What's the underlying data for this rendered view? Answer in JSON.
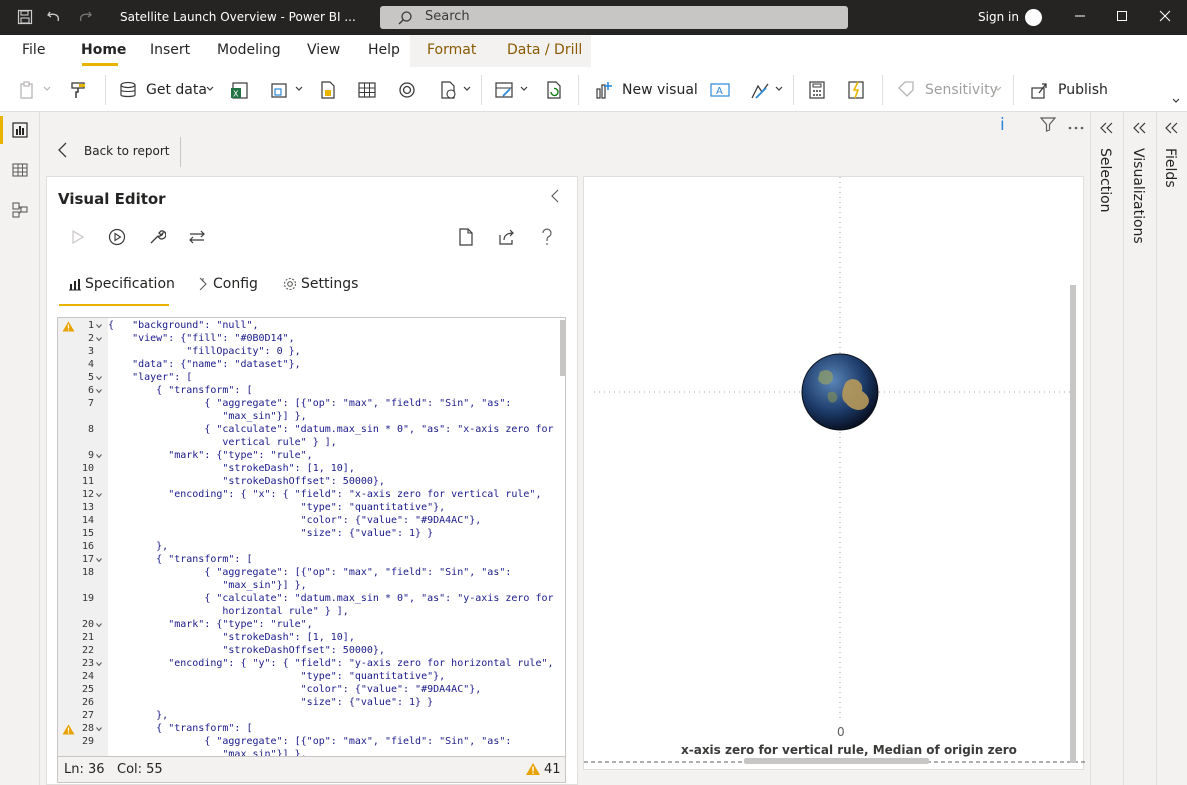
{
  "window": {
    "title": "Satellite Launch Overview - Power BI ...",
    "search_label": "Search",
    "sign_in": "Sign in"
  },
  "menu": {
    "items": [
      "File",
      "Home",
      "Insert",
      "Modeling",
      "View",
      "Help",
      "Format",
      "Data / Drill"
    ],
    "active": "Home"
  },
  "ribbon": {
    "get_data": "Get data",
    "new_visual": "New visual",
    "sensitivity": "Sensitivity",
    "publish": "Publish"
  },
  "report": {
    "back_label": "Back to report",
    "info_glyph": "i"
  },
  "editor": {
    "title": "Visual Editor",
    "tabs": [
      "Specification",
      "Config",
      "Settings"
    ],
    "active_tab": "Specification",
    "status_line": "Ln: 36",
    "status_col": "Col: 55",
    "warning_count": "41",
    "code_lines": [
      {
        "n": "1",
        "fold": true,
        "warn": true,
        "text": "{   \"background\": \"null\","
      },
      {
        "n": "2",
        "fold": true,
        "warn": false,
        "text": "    \"view\": {\"fill\": \"#0B0D14\","
      },
      {
        "n": "3",
        "fold": false,
        "warn": false,
        "text": "             \"fillOpacity\": 0 },"
      },
      {
        "n": "4",
        "fold": false,
        "warn": false,
        "text": "    \"data\": {\"name\": \"dataset\"},"
      },
      {
        "n": "5",
        "fold": true,
        "warn": false,
        "text": "    \"layer\": ["
      },
      {
        "n": "6",
        "fold": true,
        "warn": false,
        "text": "        { \"transform\": ["
      },
      {
        "n": "7",
        "fold": false,
        "warn": false,
        "text": "                { \"aggregate\": [{\"op\": \"max\", \"field\": \"Sin\", \"as\":"
      },
      {
        "n": "",
        "fold": false,
        "warn": false,
        "text": "                   \"max_sin\"}] },"
      },
      {
        "n": "8",
        "fold": false,
        "warn": false,
        "text": "                { \"calculate\": \"datum.max_sin * 0\", \"as\": \"x-axis zero for"
      },
      {
        "n": "",
        "fold": false,
        "warn": false,
        "text": "                   vertical rule\" } ],"
      },
      {
        "n": "9",
        "fold": true,
        "warn": false,
        "text": "          \"mark\": {\"type\": \"rule\","
      },
      {
        "n": "10",
        "fold": false,
        "warn": false,
        "text": "                   \"strokeDash\": [1, 10],"
      },
      {
        "n": "11",
        "fold": false,
        "warn": false,
        "text": "                   \"strokeDashOffset\": 50000},"
      },
      {
        "n": "12",
        "fold": true,
        "warn": false,
        "text": "          \"encoding\": { \"x\": { \"field\": \"x-axis zero for vertical rule\","
      },
      {
        "n": "13",
        "fold": false,
        "warn": false,
        "text": "                                \"type\": \"quantitative\"},"
      },
      {
        "n": "14",
        "fold": false,
        "warn": false,
        "text": "                                \"color\": {\"value\": \"#9DA4AC\"},"
      },
      {
        "n": "15",
        "fold": false,
        "warn": false,
        "text": "                                \"size\": {\"value\": 1} }"
      },
      {
        "n": "16",
        "fold": false,
        "warn": false,
        "text": "        },"
      },
      {
        "n": "17",
        "fold": true,
        "warn": false,
        "text": "        { \"transform\": ["
      },
      {
        "n": "18",
        "fold": false,
        "warn": false,
        "text": "                { \"aggregate\": [{\"op\": \"max\", \"field\": \"Sin\", \"as\":"
      },
      {
        "n": "",
        "fold": false,
        "warn": false,
        "text": "                   \"max_sin\"}] },"
      },
      {
        "n": "19",
        "fold": false,
        "warn": false,
        "text": "                { \"calculate\": \"datum.max_sin * 0\", \"as\": \"y-axis zero for"
      },
      {
        "n": "",
        "fold": false,
        "warn": false,
        "text": "                   horizontal rule\" } ],"
      },
      {
        "n": "20",
        "fold": true,
        "warn": false,
        "text": "          \"mark\": {\"type\": \"rule\","
      },
      {
        "n": "21",
        "fold": false,
        "warn": false,
        "text": "                   \"strokeDash\": [1, 10],"
      },
      {
        "n": "22",
        "fold": false,
        "warn": false,
        "text": "                   \"strokeDashOffset\": 50000},"
      },
      {
        "n": "23",
        "fold": true,
        "warn": false,
        "text": "          \"encoding\": { \"y\": { \"field\": \"y-axis zero for horizontal rule\","
      },
      {
        "n": "24",
        "fold": false,
        "warn": false,
        "text": "                                \"type\": \"quantitative\"},"
      },
      {
        "n": "25",
        "fold": false,
        "warn": false,
        "text": "                                \"color\": {\"value\": \"#9DA4AC\"},"
      },
      {
        "n": "26",
        "fold": false,
        "warn": false,
        "text": "                                \"size\": {\"value\": 1} }"
      },
      {
        "n": "27",
        "fold": false,
        "warn": false,
        "text": "        },"
      },
      {
        "n": "28",
        "fold": true,
        "warn": true,
        "text": "        { \"transform\": ["
      },
      {
        "n": "29",
        "fold": false,
        "warn": false,
        "text": "                { \"aggregate\": [{\"op\": \"max\", \"field\": \"Sin\", \"as\":"
      },
      {
        "n": "",
        "fold": false,
        "warn": false,
        "text": "                   \"max_sin\"}] },"
      }
    ]
  },
  "preview": {
    "axis_tick": "0",
    "axis_title": "x-axis zero for vertical rule, Median of origin zero"
  },
  "panes": {
    "selection": "Selection",
    "visualizations": "Visualizations",
    "fields": "Fields"
  },
  "colors": {
    "accent": "#e8b400",
    "titlebar": "#252423",
    "rule": "#9DA4AC",
    "warning": "#e8a200"
  }
}
